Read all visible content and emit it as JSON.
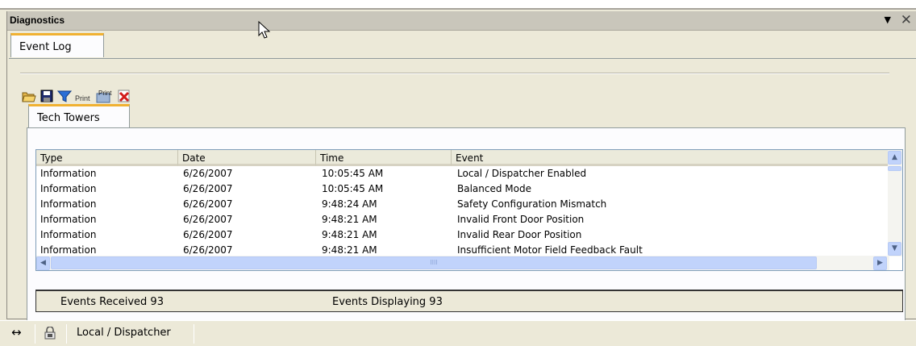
{
  "window": {
    "title": "Diagnostics"
  },
  "outer_tab": {
    "label": "Event Log"
  },
  "toolbar": {
    "icons": [
      "open-folder-icon",
      "save-icon",
      "filter-icon",
      "print-icon",
      "print-preview-icon",
      "clear-icon"
    ],
    "print_label": "Print",
    "print_preview_label": "Print"
  },
  "inner_tab": {
    "label": "Tech Towers"
  },
  "table": {
    "columns": [
      "Type",
      "Date",
      "Time",
      "Event"
    ],
    "rows": [
      [
        "Information",
        "6/26/2007",
        "10:05:45 AM",
        "Local / Dispatcher Enabled"
      ],
      [
        "Information",
        "6/26/2007",
        "10:05:45 AM",
        "Balanced Mode"
      ],
      [
        "Information",
        "6/26/2007",
        "9:48:24 AM",
        "Safety Configuration Mismatch"
      ],
      [
        "Information",
        "6/26/2007",
        "9:48:21 AM",
        "Invalid Front Door Position"
      ],
      [
        "Information",
        "6/26/2007",
        "9:48:21 AM",
        "Invalid Rear Door Position"
      ],
      [
        "Information",
        "6/26/2007",
        "9:48:21 AM",
        "Insufficient Motor Field Feedback Fault"
      ]
    ],
    "hscroll_grip": "IIII"
  },
  "status": {
    "received": "Events Received 93",
    "displaying": "Events Displaying 93"
  },
  "bottom_bar": {
    "arrows_icon": "↔",
    "lock_icon": "lock-icon",
    "mode_label": "Local / Dispatcher"
  },
  "colors": {
    "tab_accent": "#f0b132",
    "scroll": "#c1d3fb",
    "title_bar": "#c9c6bb"
  }
}
